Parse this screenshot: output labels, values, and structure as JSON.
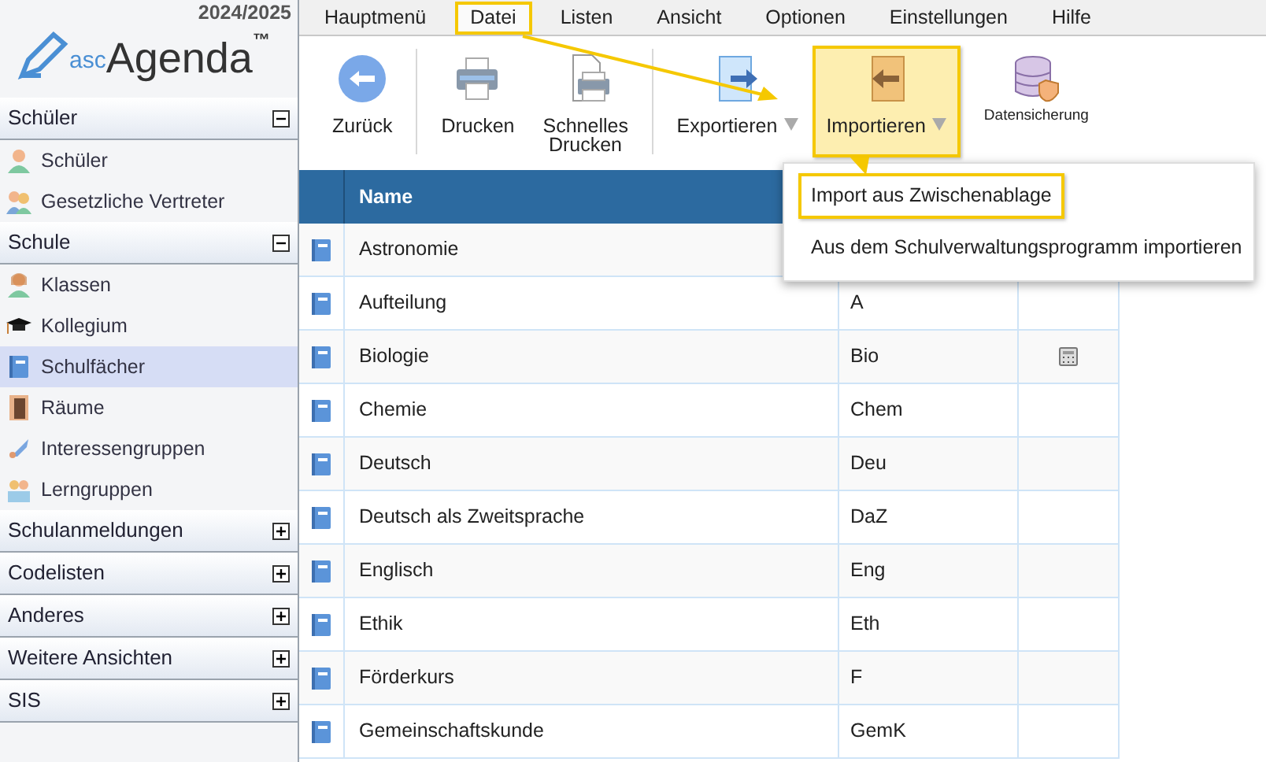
{
  "logo": {
    "prefix": "asc",
    "name": "Agenda",
    "mark": "™",
    "year": "2024/2025"
  },
  "sidebar": [
    {
      "title": "Schüler",
      "expanded": true,
      "items": [
        {
          "label": "Schüler",
          "selected": false
        },
        {
          "label": "Gesetzliche Vertreter",
          "selected": false
        }
      ]
    },
    {
      "title": "Schule",
      "expanded": true,
      "items": [
        {
          "label": "Klassen",
          "selected": false
        },
        {
          "label": "Kollegium",
          "selected": false
        },
        {
          "label": "Schulfächer",
          "selected": true
        },
        {
          "label": "Räume",
          "selected": false
        },
        {
          "label": "Interessengruppen",
          "selected": false
        },
        {
          "label": "Lerngruppen",
          "selected": false
        }
      ]
    },
    {
      "title": "Schulanmeldungen",
      "expanded": false
    },
    {
      "title": "Codelisten",
      "expanded": false
    },
    {
      "title": "Anderes",
      "expanded": false
    },
    {
      "title": "Weitere Ansichten",
      "expanded": false
    },
    {
      "title": "SIS",
      "expanded": false
    }
  ],
  "menu": [
    {
      "label": "Hauptmenü",
      "highlighted": false
    },
    {
      "label": "Datei",
      "highlighted": true
    },
    {
      "label": "Listen",
      "highlighted": false
    },
    {
      "label": "Ansicht",
      "highlighted": false
    },
    {
      "label": "Optionen",
      "highlighted": false
    },
    {
      "label": "Einstellungen",
      "highlighted": false
    },
    {
      "label": "Hilfe",
      "highlighted": false
    }
  ],
  "toolbar": [
    {
      "label": "Zurück",
      "highlighted": false,
      "dropdown": false
    },
    {
      "label": "Drucken",
      "highlighted": false,
      "dropdown": false
    },
    {
      "label": "Schnelles Drucken",
      "highlighted": false,
      "dropdown": false
    },
    {
      "label": "Exportieren",
      "highlighted": false,
      "dropdown": true
    },
    {
      "label": "Importieren",
      "highlighted": true,
      "dropdown": true
    },
    {
      "label": "Datensicherung",
      "highlighted": false,
      "dropdown": false
    }
  ],
  "dropdown_menu": [
    {
      "label": "Import aus Zwischenablage",
      "highlighted": true
    },
    {
      "label": "Aus dem Schulverwaltungsprogramm importieren",
      "highlighted": false
    }
  ],
  "table": {
    "columns": [
      "Name"
    ],
    "rows": [
      {
        "name": "Astronomie"
      },
      {
        "name": "Aufteilung",
        "short": "A"
      },
      {
        "name": "Biologie",
        "short": "Bio",
        "has_calculator": true
      },
      {
        "name": "Chemie",
        "short": "Chem"
      },
      {
        "name": "Deutsch",
        "short": "Deu"
      },
      {
        "name": "Deutsch als Zweitsprache",
        "short": "DaZ"
      },
      {
        "name": "Englisch",
        "short": "Eng"
      },
      {
        "name": "Ethik",
        "short": "Eth"
      },
      {
        "name": "Förderkurs",
        "short": "F"
      },
      {
        "name": "Gemeinschaftskunde",
        "short": "GemK"
      }
    ]
  }
}
